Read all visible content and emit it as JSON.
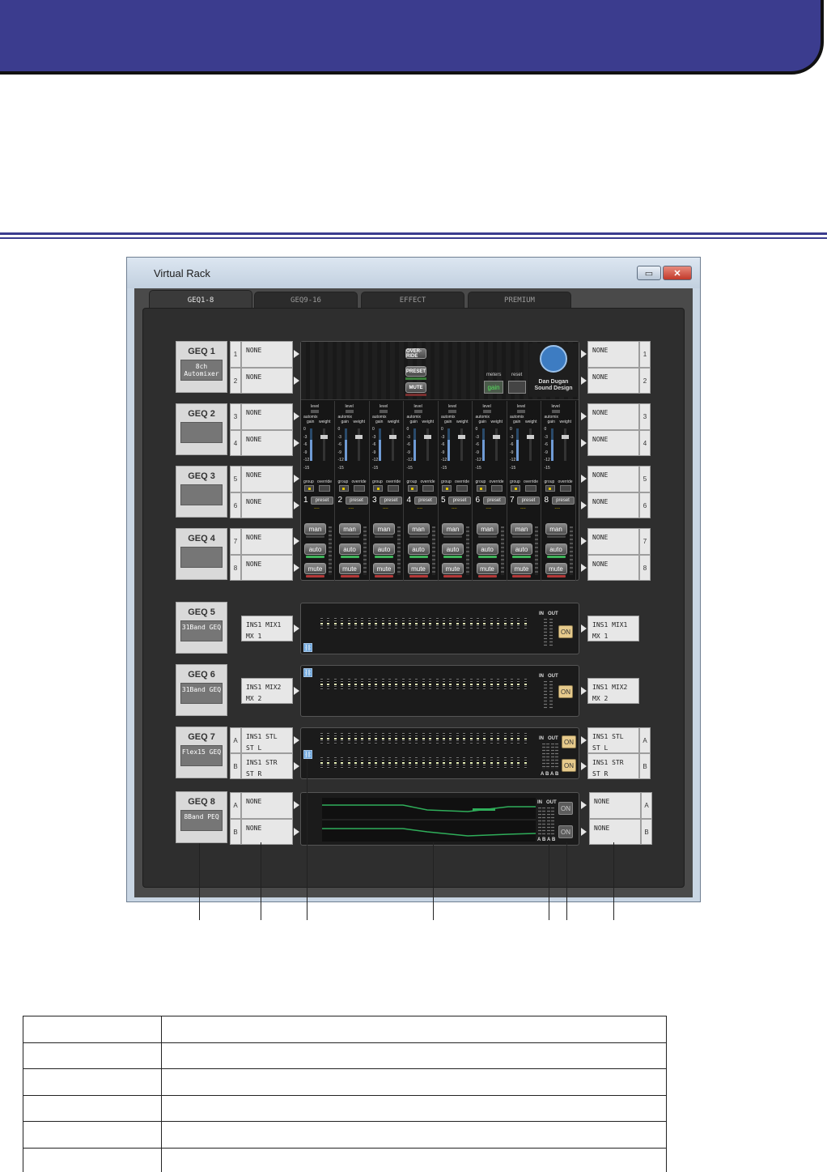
{
  "window": {
    "title": "Virtual Rack",
    "minimize": "▭",
    "close": "✕"
  },
  "tabs": [
    {
      "label": "GEQ1-8",
      "active": true
    },
    {
      "label": "GEQ9-16",
      "active": false
    },
    {
      "label": "EFFECT",
      "active": false
    },
    {
      "label": "PREMIUM",
      "active": false
    }
  ],
  "racks": [
    {
      "name": "GEQ 1",
      "sub": "8ch Automixer",
      "left": [
        "1",
        "2"
      ],
      "in": [
        "NONE",
        "NONE"
      ],
      "right": [
        "1",
        "2"
      ],
      "out": [
        "NONE",
        "NONE"
      ]
    },
    {
      "name": "GEQ 2",
      "sub": "",
      "left": [
        "3",
        "4"
      ],
      "in": [
        "NONE",
        "NONE"
      ],
      "right": [
        "3",
        "4"
      ],
      "out": [
        "NONE",
        "NONE"
      ]
    },
    {
      "name": "GEQ 3",
      "sub": "",
      "left": [
        "5",
        "6"
      ],
      "in": [
        "NONE",
        "NONE"
      ],
      "right": [
        "5",
        "6"
      ],
      "out": [
        "NONE",
        "NONE"
      ]
    },
    {
      "name": "GEQ 4",
      "sub": "",
      "left": [
        "7",
        "8"
      ],
      "in": [
        "NONE",
        "NONE"
      ],
      "right": [
        "7",
        "8"
      ],
      "out": [
        "NONE",
        "NONE"
      ]
    },
    {
      "name": "GEQ 5",
      "sub": "31Band GEQ",
      "in_a": "INS1 MIX1",
      "in_b": "MX 1",
      "out_a": "INS1 MIX1",
      "out_b": "MX 1"
    },
    {
      "name": "GEQ 6",
      "sub": "31Band GEQ",
      "in_a": "INS1 MIX2",
      "in_b": "MX 2",
      "out_a": "INS1 MIX2",
      "out_b": "MX 2"
    },
    {
      "name": "GEQ 7",
      "sub": "Flex15 GEQ",
      "left": [
        "A",
        "B"
      ],
      "in": [
        "INS1 STL\nST L",
        "INS1 STR\nST R"
      ],
      "right": [
        "A",
        "B"
      ],
      "out": [
        "INS1 STL\nST L",
        "INS1 STR\nST R"
      ]
    },
    {
      "name": "GEQ 8",
      "sub": "8Band PEQ",
      "left": [
        "A",
        "B"
      ],
      "in": [
        "NONE",
        "NONE"
      ],
      "right": [
        "A",
        "B"
      ],
      "out": [
        "NONE",
        "NONE"
      ]
    }
  ],
  "automixer": {
    "override": "OVER-RIDE",
    "preset": "PRESET",
    "mute": "MUTE",
    "meters_label": "meters",
    "reset_label": "reset",
    "gain_label": "gain",
    "brand_line1": "Dan Dugan",
    "brand_line2": "Sound Design",
    "channel_labels": {
      "level": "level",
      "automix": "automix",
      "gain": "gain",
      "weight": "weight",
      "group": "group",
      "override": "override",
      "preset": "preset",
      "dashes": "----"
    },
    "scale": [
      "0",
      "-3",
      "-6",
      "-9",
      "-12",
      "-15"
    ],
    "channels": [
      "1",
      "2",
      "3",
      "4",
      "5",
      "6",
      "7",
      "8"
    ],
    "buttons": {
      "man": "man",
      "auto": "auto",
      "mute": "mute"
    }
  },
  "eq": {
    "in": "IN",
    "out": "OUT",
    "on": "ON",
    "a": "A",
    "b": "B"
  },
  "colors": {
    "accent": "#3b3c8e",
    "on": "#e6ca8c",
    "auto_led": "#3fb35a",
    "mute_led": "#b33a3a",
    "curve": "#2fae5a"
  }
}
